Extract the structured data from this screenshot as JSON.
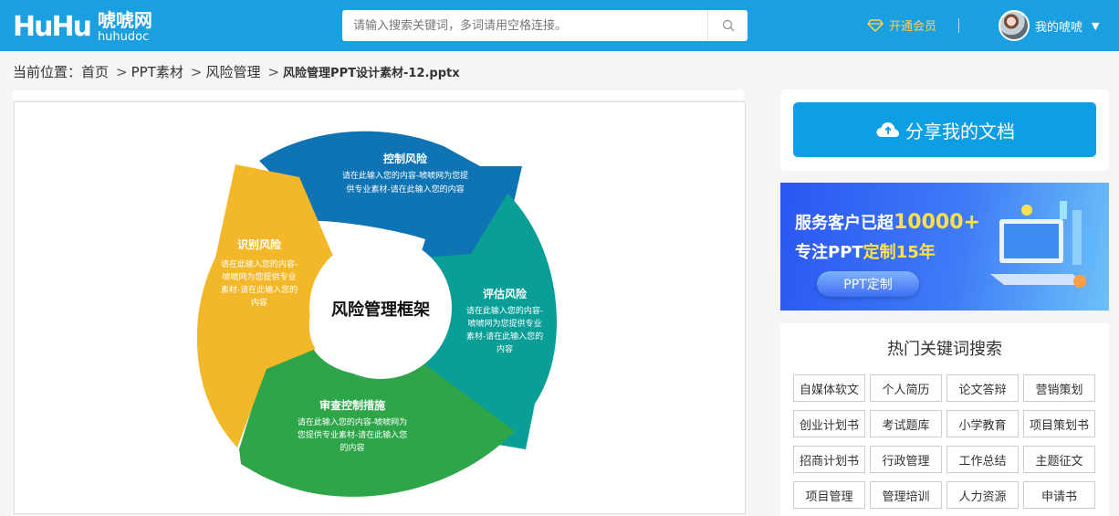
{
  "header": {
    "logo_mark": "HuHu",
    "logo_cn": "唬唬网",
    "logo_en": "huhudoc",
    "search_placeholder": "请输入搜索关键词，多词请用空格连接。",
    "vip_label": "开通会员",
    "user_name": "我的唬唬",
    "accent_color": "#1a9fe0",
    "vip_color": "#ffd34d"
  },
  "breadcrumb": {
    "prefix": "当前位置：",
    "items": [
      "首页",
      "PPT素材",
      "风险管理"
    ],
    "separator": ">",
    "current": "风险管理PPT设计素材-12.pptx"
  },
  "diagram": {
    "center_title": "风险管理框架",
    "segments": [
      {
        "title": "控制风险",
        "line1": "请在此输入您的内容-唬唬网为您提",
        "line2": "供专业素材-请在此输入您的内容",
        "color": "#0f74b4"
      },
      {
        "title": "评估风险",
        "line1": "请在此输入您的内容-",
        "line2": "唬唬网为您提供专业",
        "line3": "素材-请在此输入您的",
        "line4": "内容",
        "color": "#0a9e96"
      },
      {
        "title": "审查控制措施",
        "line1": "请在此输入您的内容-唬唬网为",
        "line2": "您提供专业素材-请在此输入您",
        "line3": "的内容",
        "color": "#2ea548"
      },
      {
        "title": "识别风险",
        "line1": "请在此输入您的内容-",
        "line2": "唬唬网为您提供专业",
        "line3": "素材-请在此输入您的",
        "line4": "内容",
        "color": "#f3b82a"
      }
    ]
  },
  "sidebar": {
    "share_label": "分享我的文档",
    "banner": {
      "line1_prefix": "服务客户已超",
      "line1_highlight": "10000+",
      "line2_prefix": "专注PPT",
      "line2_highlight": "定制15年",
      "button": "PPT定制"
    },
    "keywords_title": "热门关键词搜索",
    "keywords": [
      "自媒体软文",
      "个人简历",
      "论文答辩",
      "营销策划",
      "创业计划书",
      "考试题库",
      "小学教育",
      "项目策划书",
      "招商计划书",
      "行政管理",
      "工作总结",
      "主题征文",
      "项目管理",
      "管理培训",
      "人力资源",
      "申请书"
    ]
  }
}
